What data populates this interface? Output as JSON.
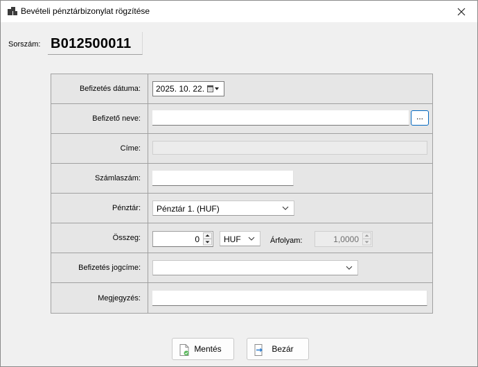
{
  "window": {
    "title": "Bevételi pénztárbizonylat rögzítése"
  },
  "header": {
    "sorszam_label": "Sorszám:",
    "sorszam_value": "B012500011"
  },
  "form": {
    "befizetes_datuma": {
      "label": "Befizetés dátuma:",
      "value": "2025. 10. 22."
    },
    "befizeto_neve": {
      "label": "Befizető neve:",
      "value": "",
      "browse_label": "..."
    },
    "cime": {
      "label": "Címe:",
      "value": ""
    },
    "szamlaszam": {
      "label": "Számlaszám:",
      "value": ""
    },
    "penztar": {
      "label": "Pénztár:",
      "value": "Pénztár 1. (HUF)"
    },
    "osszeg": {
      "label": "Összeg:",
      "value": "0",
      "currency": "HUF"
    },
    "arfolyam": {
      "label": "Árfolyam:",
      "value": "1,0000"
    },
    "befizetes_jogcime": {
      "label": "Befizetés jogcíme:",
      "value": ""
    },
    "megjegyzes": {
      "label": "Megjegyzés:",
      "value": ""
    }
  },
  "buttons": {
    "save_label": "Mentés",
    "close_label": "Bezár"
  },
  "colors": {
    "accent": "#0067c0",
    "grid_bg": "#e6e6e6",
    "window_bg": "#f0f0f0"
  }
}
